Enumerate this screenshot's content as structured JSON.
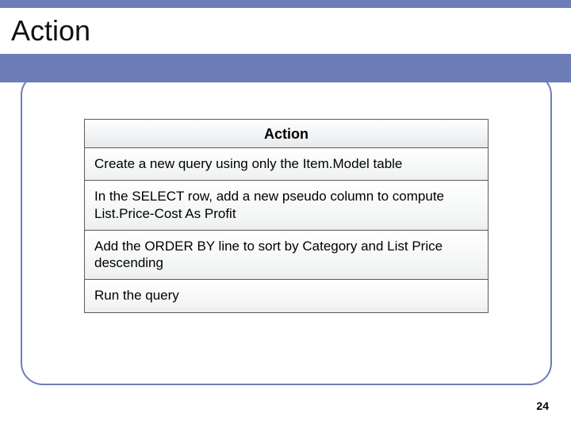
{
  "title": "Action",
  "table": {
    "header": "Action",
    "rows": [
      "Create a new query using only the Item.Model table",
      "In the SELECT row, add a new pseudo column to compute List.Price-Cost As Profit",
      "Add the ORDER BY line to sort by Category and List Price descending",
      "Run the query"
    ]
  },
  "pageNumber": "24"
}
